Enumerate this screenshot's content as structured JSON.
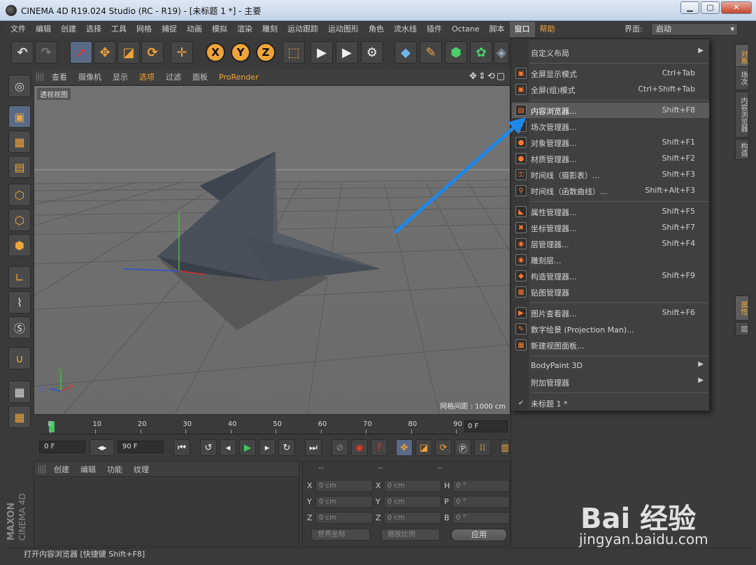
{
  "window": {
    "title": "CINEMA 4D R19.024 Studio (RC - R19) - [未标题 1 *] - 主要",
    "buttons": [
      "▁",
      "▢",
      "✕"
    ]
  },
  "menubar": {
    "items": [
      "文件",
      "编辑",
      "创建",
      "选择",
      "工具",
      "网格",
      "捕捉",
      "动画",
      "模拟",
      "渲染",
      "雕刻",
      "运动跟踪",
      "运动图形",
      "角色",
      "流水线",
      "插件",
      "Octane",
      "脚本",
      "窗口",
      "帮助"
    ],
    "active": "窗口",
    "interface_label": "界面:",
    "interface_value": "启动"
  },
  "viewport": {
    "menu": [
      "查看",
      "摄像机",
      "显示",
      "选项",
      "过滤",
      "面板",
      "ProRender"
    ],
    "highlighted": [
      "选项",
      "ProRender"
    ],
    "label": "透视视图",
    "grid_info": "网格间距 : 1000 cm",
    "nav_icons": "✥⇕⟲▢",
    "axis_labels": [
      "Y",
      "Z",
      "X"
    ]
  },
  "timeline": {
    "ticks": [
      "0",
      "10",
      "20",
      "30",
      "40",
      "50",
      "60",
      "70",
      "80",
      "90"
    ],
    "current_frame": "0 F"
  },
  "transport": {
    "start_field": "0 F",
    "end_field": "90 F"
  },
  "materials_panel": {
    "menu": [
      "创建",
      "编辑",
      "功能",
      "纹理"
    ]
  },
  "coords_panel": {
    "headers": [
      "--",
      "--",
      "--"
    ],
    "rows": [
      {
        "l1": "X",
        "v1": "0 cm",
        "l2": "X",
        "v2": "0 cm",
        "l3": "H",
        "v3": "0 °"
      },
      {
        "l1": "Y",
        "v1": "0 cm",
        "l2": "Y",
        "v2": "0 cm",
        "l3": "P",
        "v3": "0 °"
      },
      {
        "l1": "Z",
        "v1": "0 cm",
        "l2": "Z",
        "v2": "0 cm",
        "l3": "B",
        "v3": "0 °"
      }
    ],
    "world_coords": "世界坐标",
    "scale": "缩放比例",
    "apply": "应用"
  },
  "branding": {
    "maxon": "MAXON",
    "cinema": "CINEMA 4D"
  },
  "statusbar": "打开内容浏览器 [快捷键 Shift+F8]",
  "right_tabs": [
    "对象",
    "场次",
    "内容浏览器",
    "构造",
    "属性",
    "层"
  ],
  "window_menu": {
    "items": [
      {
        "label": "自定义布局",
        "shortcut": "",
        "submenu": true,
        "icon": ""
      },
      {
        "label": "全屏显示模式",
        "shortcut": "Ctrl+Tab",
        "icon": "fullscreen-icon"
      },
      {
        "label": "全屏(组)模式",
        "shortcut": "Ctrl+Shift+Tab",
        "icon": "fullscreen-group-icon"
      },
      {
        "label": "内容浏览器...",
        "shortcut": "Shift+F8",
        "icon": "content-browser-icon",
        "highlight": true
      },
      {
        "label": "场次管理器...",
        "shortcut": "",
        "icon": "take-manager-icon"
      },
      {
        "label": "对象管理器...",
        "shortcut": "Shift+F1",
        "icon": "object-manager-icon"
      },
      {
        "label": "材质管理器...",
        "shortcut": "Shift+F2",
        "icon": "material-manager-icon"
      },
      {
        "label": "时间线（摄影表）...",
        "shortcut": "Shift+F3",
        "icon": "timeline-dopesheet-icon"
      },
      {
        "label": "时间线（函数曲线）...",
        "shortcut": "Shift+Alt+F3",
        "icon": "timeline-fcurve-icon"
      },
      {
        "label": "属性管理器...",
        "shortcut": "Shift+F5",
        "icon": "attribute-manager-icon"
      },
      {
        "label": "坐标管理器...",
        "shortcut": "Shift+F7",
        "icon": "coordinate-manager-icon"
      },
      {
        "label": "层管理器...",
        "shortcut": "Shift+F4",
        "icon": "layer-manager-icon"
      },
      {
        "label": "雕刻层...",
        "shortcut": "",
        "icon": "sculpt-layer-icon"
      },
      {
        "label": "构造管理器...",
        "shortcut": "Shift+F9",
        "icon": "structure-manager-icon"
      },
      {
        "label": "贴图管理器",
        "shortcut": "",
        "icon": "texture-manager-icon"
      },
      {
        "label": "图片查看器...",
        "shortcut": "Shift+F6",
        "icon": "picture-viewer-icon"
      },
      {
        "label": "数字绘景 (Projection Man)...",
        "shortcut": "",
        "icon": "projection-man-icon"
      },
      {
        "label": "新建视图面板...",
        "shortcut": "",
        "icon": "new-view-panel-icon"
      },
      {
        "label": "BodyPaint 3D",
        "shortcut": "",
        "submenu": true,
        "icon": ""
      },
      {
        "label": "附加管理器",
        "shortcut": "",
        "submenu": true,
        "icon": ""
      },
      {
        "label": "未标题 1 *",
        "shortcut": "",
        "icon": "checkmark-icon"
      }
    ]
  },
  "watermark": {
    "text": "Bai 经验",
    "url": "jingyan.baidu.com"
  }
}
